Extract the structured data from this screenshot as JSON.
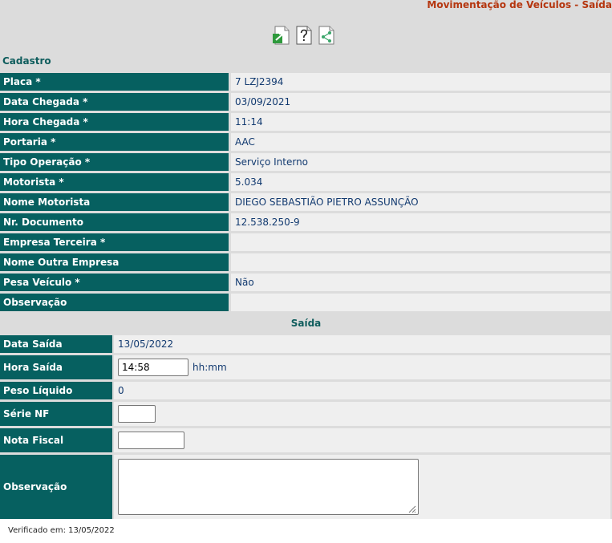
{
  "header": {
    "title": "Movimentação de Veículos - Saída"
  },
  "toolbar": {
    "icons": [
      "export-icon",
      "help-icon",
      "share-icon"
    ]
  },
  "cadastro": {
    "title": "Cadastro",
    "rows": [
      {
        "label": "Placa *",
        "value": "7 LZJ2394"
      },
      {
        "label": "Data Chegada *",
        "value": "03/09/2021"
      },
      {
        "label": "Hora Chegada *",
        "value": "11:14"
      },
      {
        "label": "Portaria *",
        "value": "AAC"
      },
      {
        "label": "Tipo Operação *",
        "value": "Serviço Interno"
      },
      {
        "label": "Motorista *",
        "value": "5.034"
      },
      {
        "label": "Nome Motorista",
        "value": "DIEGO SEBASTIÃO PIETRO ASSUNÇÃO"
      },
      {
        "label": "Nr. Documento",
        "value": "12.538.250-9"
      },
      {
        "label": "Empresa Terceira *",
        "value": ""
      },
      {
        "label": "Nome Outra Empresa",
        "value": ""
      },
      {
        "label": "Pesa Veículo *",
        "value": "Não"
      },
      {
        "label": "Observação",
        "value": ""
      }
    ]
  },
  "saida": {
    "title": "Saída",
    "data_saida": {
      "label": "Data Saída",
      "value": "13/05/2022"
    },
    "hora_saida": {
      "label": "Hora Saída",
      "value": "14:58",
      "hint": "hh:mm"
    },
    "peso_liquido": {
      "label": "Peso Líquido",
      "value": "0"
    },
    "serie_nf": {
      "label": "Série NF",
      "value": ""
    },
    "nota_fiscal": {
      "label": "Nota Fiscal",
      "value": ""
    },
    "observacao": {
      "label": "Observação",
      "value": ""
    }
  },
  "footer": {
    "text": "Verificado em: 13/05/2022"
  },
  "colors": {
    "label_bg": "#066060",
    "value_bg": "#efefef",
    "title": "#b5360f",
    "section": "#0f5d5d"
  }
}
